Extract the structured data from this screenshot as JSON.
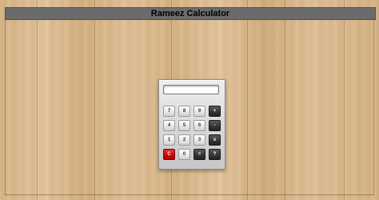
{
  "header": {
    "title": "Rameez Calculator"
  },
  "calculator": {
    "display_value": "",
    "keys": [
      {
        "label": "7",
        "type": "num",
        "name": "key-7"
      },
      {
        "label": "8",
        "type": "num",
        "name": "key-8"
      },
      {
        "label": "9",
        "type": "num",
        "name": "key-9"
      },
      {
        "label": "+",
        "type": "op",
        "name": "key-plus"
      },
      {
        "label": "4",
        "type": "num",
        "name": "key-4"
      },
      {
        "label": "5",
        "type": "num",
        "name": "key-5"
      },
      {
        "label": "6",
        "type": "num",
        "name": "key-6"
      },
      {
        "label": "-",
        "type": "op",
        "name": "key-minus"
      },
      {
        "label": "1",
        "type": "num",
        "name": "key-1"
      },
      {
        "label": "2",
        "type": "num",
        "name": "key-2"
      },
      {
        "label": "3",
        "type": "num",
        "name": "key-3"
      },
      {
        "label": "x",
        "type": "op",
        "name": "key-multiply"
      },
      {
        "label": "C",
        "type": "clear",
        "name": "key-clear"
      },
      {
        "label": "0",
        "type": "num",
        "name": "key-0"
      },
      {
        "label": "=",
        "type": "op",
        "name": "key-equals"
      },
      {
        "label": "?",
        "type": "op",
        "name": "key-divide"
      }
    ]
  },
  "colors": {
    "title_bar": "#6b6b6b",
    "clear_key": "#cc0000",
    "operator_key": "#333333",
    "background_wood": "#d9b98d"
  }
}
